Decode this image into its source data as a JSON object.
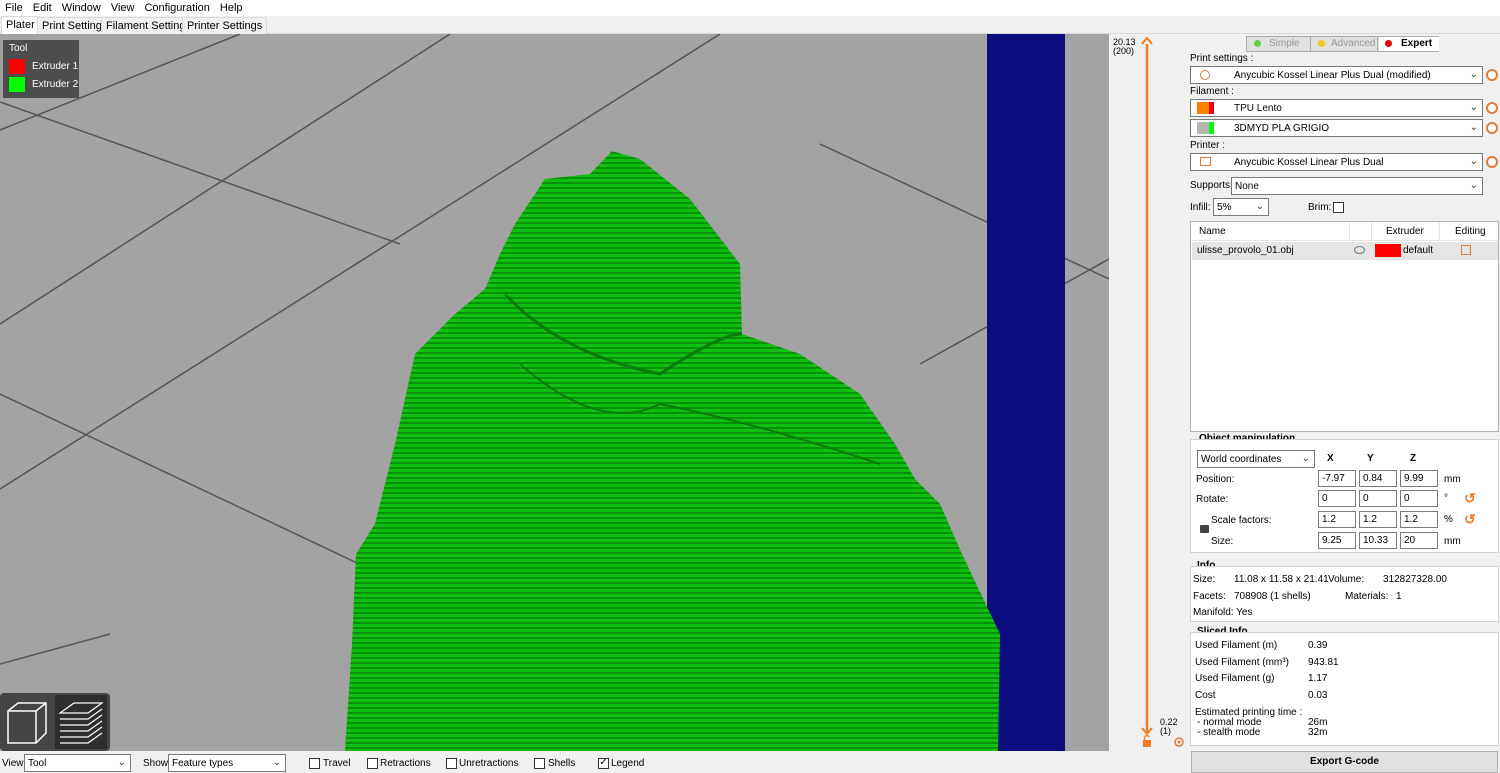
{
  "menu": [
    "File",
    "Edit",
    "Window",
    "View",
    "Configuration",
    "Help"
  ],
  "tabs": [
    "Plater",
    "Print Settings",
    "Filament Settings",
    "Printer Settings"
  ],
  "legend": {
    "title": "Tool",
    "items": [
      {
        "label": "Extruder 1",
        "color": "#ff0000"
      },
      {
        "label": "Extruder 2",
        "color": "#00ff00"
      }
    ]
  },
  "layer_slider": {
    "top_value": "20.13",
    "top_layer": "(200)",
    "bottom_value": "0.22",
    "bottom_layer": "(1)",
    "accent": "#f47b20"
  },
  "mode": {
    "simple": "Simple",
    "advanced": "Advanced",
    "expert": "Expert",
    "simple_color": "#61d13e",
    "advanced_color": "#f5c518",
    "expert_color": "#e00000"
  },
  "print_settings": {
    "label": "Print settings :",
    "value": "Anycubic Kossel Linear Plus Dual (modified)"
  },
  "filament": {
    "label": "Filament :",
    "items": [
      {
        "value": "TPU Lento",
        "color": "#ff7f00",
        "ext_color": "#ff0000"
      },
      {
        "value": "3DMYD PLA GRIGIO",
        "color": "#b5b5b5",
        "ext_color": "#00ff00"
      }
    ]
  },
  "printer": {
    "label": "Printer :",
    "value": "Anycubic Kossel Linear Plus Dual"
  },
  "supports": {
    "label": "Supports:",
    "value": "None"
  },
  "infill": {
    "label": "Infill:",
    "value": "5%"
  },
  "brim": {
    "label": "Brim:",
    "checked": false
  },
  "object_list": {
    "headers": [
      "Name",
      "Extruder",
      "Editing"
    ],
    "rows": [
      {
        "name": "ulisse_provolo_01.obj",
        "extruder": "default",
        "extruder_color": "#ff0000"
      }
    ]
  },
  "object_manipulation": {
    "title": "Object manipulation",
    "coord_system": "World coordinates",
    "axes": [
      "X",
      "Y",
      "Z"
    ],
    "rows": [
      {
        "label": "Position:",
        "values": [
          "-7.97",
          "0.84",
          "9.99"
        ],
        "unit": "mm"
      },
      {
        "label": "Rotate:",
        "values": [
          "0",
          "0",
          "0"
        ],
        "unit": "°"
      },
      {
        "label": "Scale factors:",
        "values": [
          "1.2",
          "1.2",
          "1.2"
        ],
        "unit": "%"
      },
      {
        "label": "Size:",
        "values": [
          "9.25",
          "10.33",
          "20"
        ],
        "unit": "mm"
      }
    ]
  },
  "info": {
    "title": "Info",
    "size_label": "Size:",
    "size_value": "11.08 x 11.58 x 21.41",
    "volume_label": "Volume:",
    "volume_value": "312827328.00",
    "facets_label": "Facets:",
    "facets_value": "708908 (1 shells)",
    "materials_label": "Materials:",
    "materials_value": "1",
    "manifold": "Manifold: Yes"
  },
  "sliced_info": {
    "title": "Sliced Info",
    "rows": [
      {
        "label": "Used Filament (m)",
        "value": "0.39"
      },
      {
        "label": "Used Filament (mm³)",
        "value": "943.81"
      },
      {
        "label": "Used Filament (g)",
        "value": "1.17"
      },
      {
        "label": "Cost",
        "value": "0.03"
      }
    ],
    "time_label": "Estimated printing time :",
    "normal_label": "- normal mode",
    "normal_value": "26m",
    "stealth_label": "- stealth mode",
    "stealth_value": "32m"
  },
  "export_button": "Export G-code",
  "bottom": {
    "view_label": "View",
    "view_value": "Tool",
    "show_label": "Show",
    "show_value": "Feature types",
    "checks": [
      {
        "label": "Travel",
        "checked": false
      },
      {
        "label": "Retractions",
        "checked": false
      },
      {
        "label": "Unretractions",
        "checked": false
      },
      {
        "label": "Shells",
        "checked": false
      },
      {
        "label": "Legend",
        "checked": true
      }
    ]
  }
}
